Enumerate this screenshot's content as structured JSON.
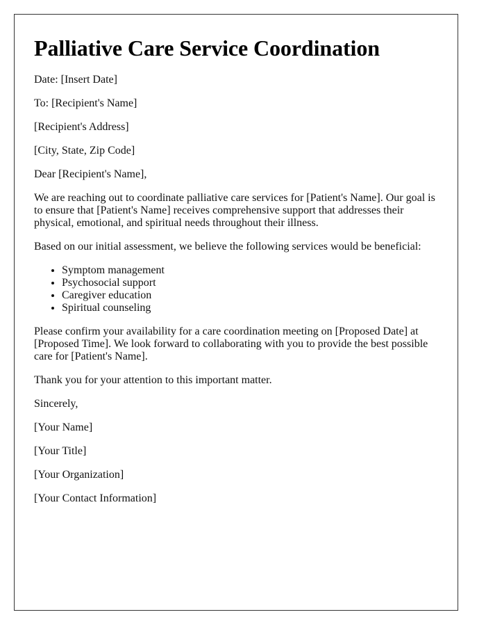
{
  "title": "Palliative Care Service Coordination",
  "date_line": "Date: [Insert Date]",
  "to_line": "To: [Recipient's Name]",
  "address_line": "[Recipient's Address]",
  "city_line": "[City, State, Zip Code]",
  "salutation": "Dear [Recipient's Name],",
  "paragraph1": "We are reaching out to coordinate palliative care services for [Patient's Name]. Our goal is to ensure that [Patient's Name] receives comprehensive support that addresses their physical, emotional, and spiritual needs throughout their illness.",
  "paragraph2": "Based on our initial assessment, we believe the following services would be beneficial:",
  "services": [
    "Symptom management",
    "Psychosocial support",
    "Caregiver education",
    "Spiritual counseling"
  ],
  "paragraph3": "Please confirm your availability for a care coordination meeting on [Proposed Date] at [Proposed Time]. We look forward to collaborating with you to provide the best possible care for [Patient's Name].",
  "paragraph4": "Thank you for your attention to this important matter.",
  "closing": "Sincerely,",
  "signature": {
    "name": "[Your Name]",
    "title": "[Your Title]",
    "organization": "[Your Organization]",
    "contact": "[Your Contact Information]"
  }
}
